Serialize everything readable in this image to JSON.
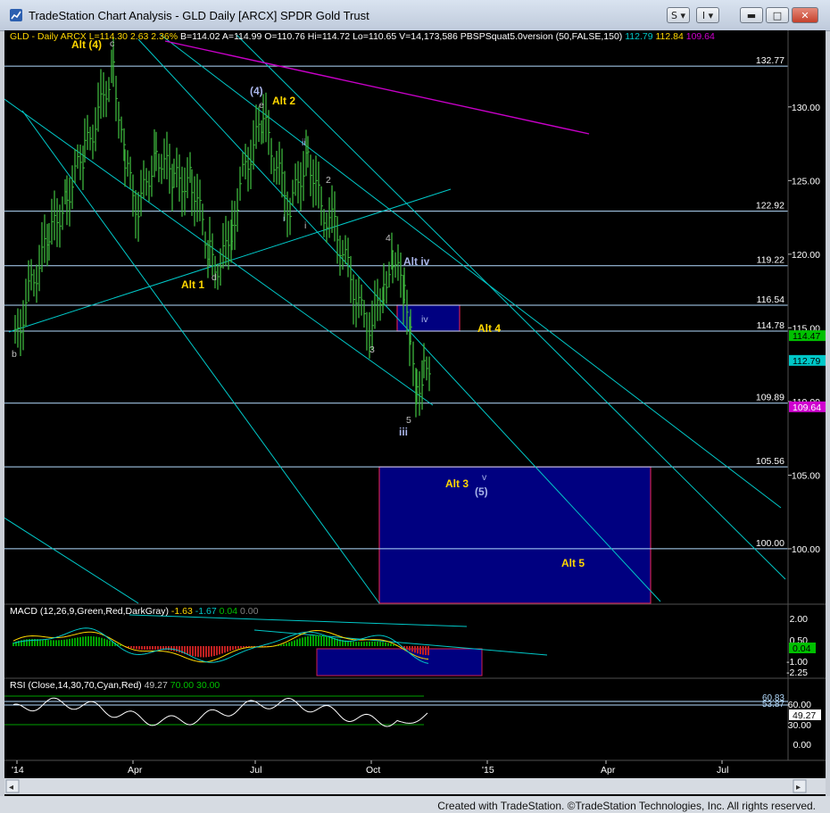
{
  "window": {
    "title": "TradeStation Chart Analysis - GLD Daily [ARCX] SPDR Gold Trust",
    "buttons": {
      "s": "S",
      "i": "I",
      "minimize": "▬",
      "maximize": "□",
      "close": "✕"
    }
  },
  "footer": {
    "credit": "Created with TradeStation. ©TradeStation Technologies, Inc. All rights reserved."
  },
  "chart_data": [
    {
      "type": "candlestick",
      "header": {
        "symbol": "GLD - Daily",
        "exchange": "ARCX",
        "last": "L=114.30",
        "change": "2.63",
        "pct": "2.36%",
        "bid": "B=114.02",
        "ask": "A=114.99",
        "open": "O=110.76",
        "hi": "Hi=114.72",
        "lo": "Lo=110.65",
        "vol": "V=14,173,586",
        "indicator": "PBSPSquat5.0version (50,FALSE,150)",
        "ind_vals": [
          "112.79",
          "112.84",
          "109.64"
        ]
      },
      "x_tick_labels": [
        "'14",
        "Apr",
        "Jul",
        "Oct",
        "'15",
        "Apr",
        "Jul"
      ],
      "y_ticks": [
        100,
        105,
        110,
        115,
        120,
        125,
        130
      ],
      "y_tick_labels": [
        "100.00",
        "105.00",
        "110.00",
        "115.00",
        "120.00",
        "125.00",
        "130.00"
      ],
      "ylim": [
        96.3,
        135.2
      ],
      "price_badges": [
        {
          "text": "114.47",
          "value": 114.47,
          "bg": "#00c000",
          "fg": "#000000"
        },
        {
          "text": "112.79",
          "value": 112.79,
          "bg": "#00c8c8",
          "fg": "#000000"
        },
        {
          "text": "109.64",
          "value": 109.64,
          "bg": "#d000d0",
          "fg": "#ffffff"
        }
      ],
      "horizontal_levels": [
        {
          "value": 132.77,
          "label": "132.77"
        },
        {
          "value": 122.92,
          "label": "122.92"
        },
        {
          "value": 119.22,
          "label": "119.22"
        },
        {
          "value": 116.54,
          "label": "116.54"
        },
        {
          "value": 114.78,
          "label": "114.78"
        },
        {
          "value": 109.89,
          "label": "109.89"
        },
        {
          "value": 105.56,
          "label": "105.56"
        },
        {
          "value": 100.0,
          "label": "100.00"
        }
      ],
      "wave_labels": [
        {
          "text": "Alt (4)",
          "color": "#ffd700"
        },
        {
          "text": "c",
          "color": "#c0c0c0"
        },
        {
          "text": "(4)",
          "color": "#a8b4e8"
        },
        {
          "text": "e",
          "color": "#c0c0c0"
        },
        {
          "text": "Alt 2",
          "color": "#ffd700"
        },
        {
          "text": "ii",
          "color": "#a8b4e8"
        },
        {
          "text": "2",
          "color": "#c0c0c0"
        },
        {
          "text": "i",
          "color": "#a8b4e8"
        },
        {
          "text": "i",
          "color": "#c0c0c0"
        },
        {
          "text": "Alt 1",
          "color": "#ffd700"
        },
        {
          "text": "d",
          "color": "#c0c0c0"
        },
        {
          "text": "b",
          "color": "#c0c0c0"
        },
        {
          "text": "4",
          "color": "#c0c0c0"
        },
        {
          "text": "Alt iv",
          "color": "#a8b4e8"
        },
        {
          "text": "3",
          "color": "#c0c0c0"
        },
        {
          "text": "iv",
          "color": "#a8b4e8"
        },
        {
          "text": "Alt 4",
          "color": "#ffd700"
        },
        {
          "text": "5",
          "color": "#c0c0c0"
        },
        {
          "text": "iii",
          "color": "#a8b4e8"
        },
        {
          "text": "v",
          "color": "#a8b4e8"
        },
        {
          "text": "(5)",
          "color": "#a8b4e8"
        },
        {
          "text": "Alt 3",
          "color": "#ffd700"
        },
        {
          "text": "Alt 5",
          "color": "#ffd700"
        }
      ],
      "target_boxes": [
        {
          "name": "iv-box",
          "y_range": [
            114.78,
            116.54
          ]
        },
        {
          "name": "wave-5-box",
          "y_range": [
            96.3,
            105.56
          ]
        }
      ],
      "colors": {
        "bars": "#3cb43c",
        "channel": "#00c8c8",
        "levels": "#b4dcff",
        "trendline": "#c800c8",
        "box_fill": "#000080",
        "box_border": "#d02050"
      }
    },
    {
      "type": "line",
      "title": "MACD (12,26,9,Green,Red,DarkGray)",
      "values": [
        "-1.63",
        "-1.67",
        "0.04",
        "0.00"
      ],
      "value_colors": [
        "#ffd700",
        "#00c8c8",
        "#00c000",
        "#808080"
      ],
      "y_tick_labels": [
        "2.00",
        "0.50",
        "-1.00",
        "-2.25"
      ],
      "badge": {
        "text": "0.04",
        "bg": "#00c000",
        "fg": "#000000"
      }
    },
    {
      "type": "line",
      "title": "RSI (Close,14,30,70,Cyan,Red)",
      "values": [
        "49.27",
        "70.00",
        "30.00"
      ],
      "value_colors": [
        "#c0c0c0",
        "#00c000",
        "#00c000"
      ],
      "y_tick_labels": [
        "60.00",
        "30.00",
        "0.00"
      ],
      "level_labels": [
        "60.83",
        "53.87"
      ],
      "badge": {
        "text": "49.27",
        "bg": "#ffffff",
        "fg": "#000000"
      }
    }
  ]
}
